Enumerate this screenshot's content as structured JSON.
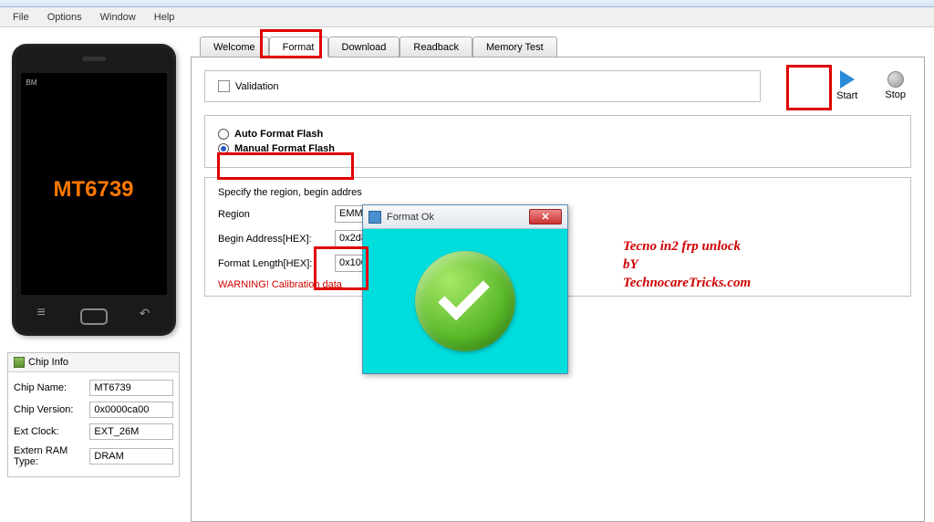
{
  "menu": {
    "file": "File",
    "options": "Options",
    "window": "Window",
    "help": "Help"
  },
  "phone": {
    "bm": "BM",
    "chip": "MT6739"
  },
  "chip_info": {
    "title": "Chip Info",
    "rows": [
      {
        "label": "Chip Name:",
        "value": "MT6739"
      },
      {
        "label": "Chip Version:",
        "value": "0x0000ca00"
      },
      {
        "label": "Ext Clock:",
        "value": "EXT_26M"
      },
      {
        "label": "Extern RAM Type:",
        "value": "DRAM"
      }
    ]
  },
  "tabs": {
    "welcome": "Welcome",
    "format": "Format",
    "download": "Download",
    "readback": "Readback",
    "memory_test": "Memory Test"
  },
  "validation": {
    "label": "Validation"
  },
  "actions": {
    "start": "Start",
    "stop": "Stop"
  },
  "format_options": {
    "auto": "Auto Format Flash",
    "manual": "Manual Format Flash"
  },
  "region": {
    "specify": "Specify the region, begin addres",
    "region_label": "Region",
    "region_value": "EMMC_US",
    "begin_label": "Begin Address[HEX]:",
    "begin_value": "0x2d880",
    "length_label": "Format Length[HEX]:",
    "length_value": "0x10000",
    "warning": "WARNING! Calibration data"
  },
  "dialog": {
    "title": "Format Ok"
  },
  "annotation": {
    "line1": "Tecno in2 frp unlock",
    "line2": "bY",
    "line3": "TechnocareTricks.com"
  }
}
